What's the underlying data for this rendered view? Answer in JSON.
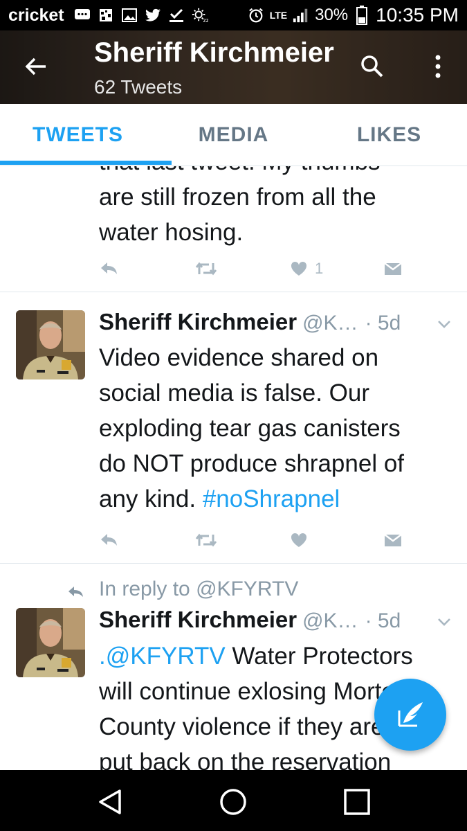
{
  "status_bar": {
    "carrier": "cricket",
    "lte": "LTE",
    "battery": "30%",
    "time": "10:35 PM"
  },
  "header": {
    "title": "Sheriff Kirchmeier",
    "subtitle": "62 Tweets"
  },
  "tabs": [
    {
      "label": "TWEETS",
      "active": true
    },
    {
      "label": "MEDIA",
      "active": false
    },
    {
      "label": "LIKES",
      "active": false
    }
  ],
  "tweets": [
    {
      "partial_top_line": "that last tweet. My thumbs",
      "text_lines": [
        "are still frozen from all the",
        "water hosing."
      ],
      "like_count": "1"
    },
    {
      "name": "Sheriff Kirchmeier",
      "handle": "@K…",
      "date": "· 5d",
      "text_lines": [
        "Video evidence shared on",
        "social media is false. Our",
        "exploding tear gas canisters",
        "do NOT produce shrapnel of"
      ],
      "last_line_prefix": "any kind. ",
      "hashtag": "#noShrapnel"
    },
    {
      "reply_context": "In reply to @KFYRTV",
      "name": "Sheriff Kirchmeier",
      "handle": "@K…",
      "date": "· 5d",
      "mention": ".@KFYRTV",
      "first_line_rest": " Water Protectors",
      "text_lines": [
        "will continue exlosing Morton",
        "County violence if they are not",
        "put back on the reservation"
      ]
    }
  ],
  "colors": {
    "accent": "#1da1f2",
    "text": "#14171a",
    "secondary": "#8899a6",
    "icon_grey": "#aab8c2"
  }
}
